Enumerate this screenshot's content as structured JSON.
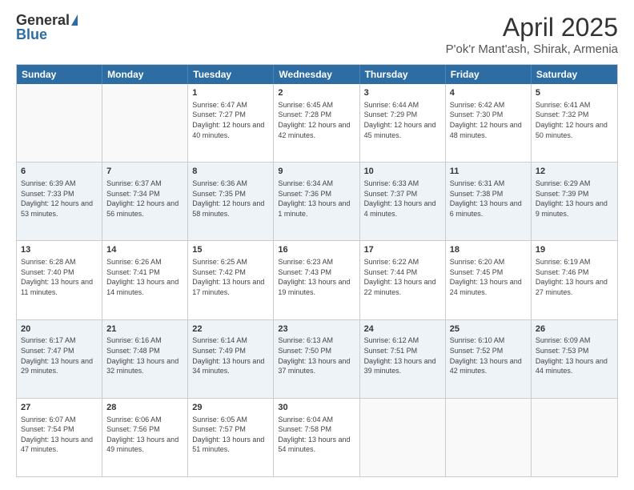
{
  "header": {
    "logo_general": "General",
    "logo_blue": "Blue",
    "title": "April 2025",
    "subtitle": "P'ok'r Mant'ash, Shirak, Armenia"
  },
  "weekdays": [
    "Sunday",
    "Monday",
    "Tuesday",
    "Wednesday",
    "Thursday",
    "Friday",
    "Saturday"
  ],
  "weeks": [
    [
      {
        "day": "",
        "sunrise": "",
        "sunset": "",
        "daylight": ""
      },
      {
        "day": "",
        "sunrise": "",
        "sunset": "",
        "daylight": ""
      },
      {
        "day": "1",
        "sunrise": "Sunrise: 6:47 AM",
        "sunset": "Sunset: 7:27 PM",
        "daylight": "Daylight: 12 hours and 40 minutes."
      },
      {
        "day": "2",
        "sunrise": "Sunrise: 6:45 AM",
        "sunset": "Sunset: 7:28 PM",
        "daylight": "Daylight: 12 hours and 42 minutes."
      },
      {
        "day": "3",
        "sunrise": "Sunrise: 6:44 AM",
        "sunset": "Sunset: 7:29 PM",
        "daylight": "Daylight: 12 hours and 45 minutes."
      },
      {
        "day": "4",
        "sunrise": "Sunrise: 6:42 AM",
        "sunset": "Sunset: 7:30 PM",
        "daylight": "Daylight: 12 hours and 48 minutes."
      },
      {
        "day": "5",
        "sunrise": "Sunrise: 6:41 AM",
        "sunset": "Sunset: 7:32 PM",
        "daylight": "Daylight: 12 hours and 50 minutes."
      }
    ],
    [
      {
        "day": "6",
        "sunrise": "Sunrise: 6:39 AM",
        "sunset": "Sunset: 7:33 PM",
        "daylight": "Daylight: 12 hours and 53 minutes."
      },
      {
        "day": "7",
        "sunrise": "Sunrise: 6:37 AM",
        "sunset": "Sunset: 7:34 PM",
        "daylight": "Daylight: 12 hours and 56 minutes."
      },
      {
        "day": "8",
        "sunrise": "Sunrise: 6:36 AM",
        "sunset": "Sunset: 7:35 PM",
        "daylight": "Daylight: 12 hours and 58 minutes."
      },
      {
        "day": "9",
        "sunrise": "Sunrise: 6:34 AM",
        "sunset": "Sunset: 7:36 PM",
        "daylight": "Daylight: 13 hours and 1 minute."
      },
      {
        "day": "10",
        "sunrise": "Sunrise: 6:33 AM",
        "sunset": "Sunset: 7:37 PM",
        "daylight": "Daylight: 13 hours and 4 minutes."
      },
      {
        "day": "11",
        "sunrise": "Sunrise: 6:31 AM",
        "sunset": "Sunset: 7:38 PM",
        "daylight": "Daylight: 13 hours and 6 minutes."
      },
      {
        "day": "12",
        "sunrise": "Sunrise: 6:29 AM",
        "sunset": "Sunset: 7:39 PM",
        "daylight": "Daylight: 13 hours and 9 minutes."
      }
    ],
    [
      {
        "day": "13",
        "sunrise": "Sunrise: 6:28 AM",
        "sunset": "Sunset: 7:40 PM",
        "daylight": "Daylight: 13 hours and 11 minutes."
      },
      {
        "day": "14",
        "sunrise": "Sunrise: 6:26 AM",
        "sunset": "Sunset: 7:41 PM",
        "daylight": "Daylight: 13 hours and 14 minutes."
      },
      {
        "day": "15",
        "sunrise": "Sunrise: 6:25 AM",
        "sunset": "Sunset: 7:42 PM",
        "daylight": "Daylight: 13 hours and 17 minutes."
      },
      {
        "day": "16",
        "sunrise": "Sunrise: 6:23 AM",
        "sunset": "Sunset: 7:43 PM",
        "daylight": "Daylight: 13 hours and 19 minutes."
      },
      {
        "day": "17",
        "sunrise": "Sunrise: 6:22 AM",
        "sunset": "Sunset: 7:44 PM",
        "daylight": "Daylight: 13 hours and 22 minutes."
      },
      {
        "day": "18",
        "sunrise": "Sunrise: 6:20 AM",
        "sunset": "Sunset: 7:45 PM",
        "daylight": "Daylight: 13 hours and 24 minutes."
      },
      {
        "day": "19",
        "sunrise": "Sunrise: 6:19 AM",
        "sunset": "Sunset: 7:46 PM",
        "daylight": "Daylight: 13 hours and 27 minutes."
      }
    ],
    [
      {
        "day": "20",
        "sunrise": "Sunrise: 6:17 AM",
        "sunset": "Sunset: 7:47 PM",
        "daylight": "Daylight: 13 hours and 29 minutes."
      },
      {
        "day": "21",
        "sunrise": "Sunrise: 6:16 AM",
        "sunset": "Sunset: 7:48 PM",
        "daylight": "Daylight: 13 hours and 32 minutes."
      },
      {
        "day": "22",
        "sunrise": "Sunrise: 6:14 AM",
        "sunset": "Sunset: 7:49 PM",
        "daylight": "Daylight: 13 hours and 34 minutes."
      },
      {
        "day": "23",
        "sunrise": "Sunrise: 6:13 AM",
        "sunset": "Sunset: 7:50 PM",
        "daylight": "Daylight: 13 hours and 37 minutes."
      },
      {
        "day": "24",
        "sunrise": "Sunrise: 6:12 AM",
        "sunset": "Sunset: 7:51 PM",
        "daylight": "Daylight: 13 hours and 39 minutes."
      },
      {
        "day": "25",
        "sunrise": "Sunrise: 6:10 AM",
        "sunset": "Sunset: 7:52 PM",
        "daylight": "Daylight: 13 hours and 42 minutes."
      },
      {
        "day": "26",
        "sunrise": "Sunrise: 6:09 AM",
        "sunset": "Sunset: 7:53 PM",
        "daylight": "Daylight: 13 hours and 44 minutes."
      }
    ],
    [
      {
        "day": "27",
        "sunrise": "Sunrise: 6:07 AM",
        "sunset": "Sunset: 7:54 PM",
        "daylight": "Daylight: 13 hours and 47 minutes."
      },
      {
        "day": "28",
        "sunrise": "Sunrise: 6:06 AM",
        "sunset": "Sunset: 7:56 PM",
        "daylight": "Daylight: 13 hours and 49 minutes."
      },
      {
        "day": "29",
        "sunrise": "Sunrise: 6:05 AM",
        "sunset": "Sunset: 7:57 PM",
        "daylight": "Daylight: 13 hours and 51 minutes."
      },
      {
        "day": "30",
        "sunrise": "Sunrise: 6:04 AM",
        "sunset": "Sunset: 7:58 PM",
        "daylight": "Daylight: 13 hours and 54 minutes."
      },
      {
        "day": "",
        "sunrise": "",
        "sunset": "",
        "daylight": ""
      },
      {
        "day": "",
        "sunrise": "",
        "sunset": "",
        "daylight": ""
      },
      {
        "day": "",
        "sunrise": "",
        "sunset": "",
        "daylight": ""
      }
    ]
  ]
}
